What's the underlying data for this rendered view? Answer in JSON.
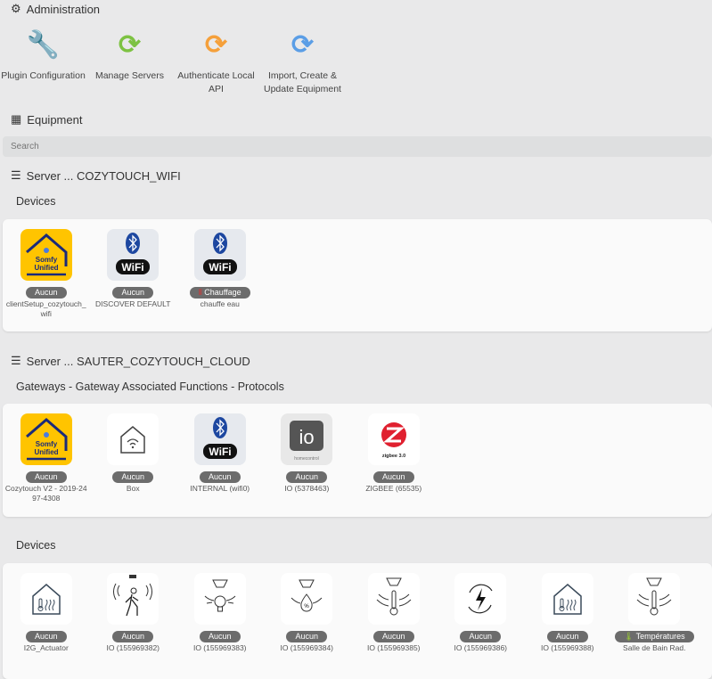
{
  "administration": {
    "title": "Administration",
    "items": [
      {
        "label": "Plugin Configuration",
        "icon": "wrench-icon"
      },
      {
        "label": "Manage Servers",
        "icon": "sync-icon",
        "color": "#7dc242"
      },
      {
        "label": "Authenticate Local API",
        "icon": "sync-icon",
        "color": "#f5a03b"
      },
      {
        "label": "Import, Create & Update Equipment",
        "icon": "sync-icon",
        "color": "#5b9ee6"
      }
    ]
  },
  "equipment": {
    "title": "Equipment",
    "search_placeholder": "Search"
  },
  "servers": [
    {
      "title": "Server ... COZYTOUCH_WIFI",
      "sections": [
        {
          "title": "Devices",
          "items": [
            {
              "icon": "somfy",
              "badge": "Aucun",
              "name": "clientSetup_cozytouch_wifi"
            },
            {
              "icon": "bt-wifi",
              "badge": "Aucun",
              "name": "DISCOVER DEFAULT"
            },
            {
              "icon": "bt-wifi",
              "badge": "Chauffage",
              "badge_icon": "heater-icon",
              "name": "chauffe eau"
            }
          ]
        }
      ]
    },
    {
      "title": "Server ... SAUTER_COZYTOUCH_CLOUD",
      "sections": [
        {
          "title": "Gateways - Gateway Associated Functions - Protocols",
          "items": [
            {
              "icon": "somfy",
              "badge": "Aucun",
              "name": "Cozytouch V2 - 2019-2497-4308"
            },
            {
              "icon": "box",
              "badge": "Aucun",
              "name": "Box"
            },
            {
              "icon": "bt-wifi",
              "badge": "Aucun",
              "name": "INTERNAL (wifi0)"
            },
            {
              "icon": "io",
              "badge": "Aucun",
              "name": "IO (5378463)"
            },
            {
              "icon": "zigbee",
              "badge": "Aucun",
              "name": "ZIGBEE (65535)"
            }
          ]
        },
        {
          "title": "Devices",
          "items": [
            {
              "icon": "house-heat",
              "badge": "Aucun",
              "name": "I2G_Actuator"
            },
            {
              "icon": "motion",
              "badge": "Aucun",
              "name": "IO (155969382)"
            },
            {
              "icon": "light-sensor",
              "badge": "Aucun",
              "name": "IO (155969383)"
            },
            {
              "icon": "humidity-sensor",
              "badge": "Aucun",
              "name": "IO (155969384)"
            },
            {
              "icon": "temp-sensor",
              "badge": "Aucun",
              "name": "IO (155969385)"
            },
            {
              "icon": "energy",
              "badge": "Aucun",
              "name": "IO (155969386)"
            },
            {
              "icon": "house-heat",
              "badge": "Aucun",
              "name": "IO (155969388)"
            },
            {
              "icon": "temp-sensor",
              "badge": "Températures",
              "badge_icon": "thermometer-icon",
              "name": "Salle de Bain Rad."
            }
          ]
        }
      ]
    }
  ],
  "labels": {
    "somfy_line1": "Somfy",
    "somfy_line2": "Unified",
    "wifi": "WiFi",
    "io": "io",
    "io_sub": "homecontrol",
    "zigbee": "zigbee 3.0"
  }
}
